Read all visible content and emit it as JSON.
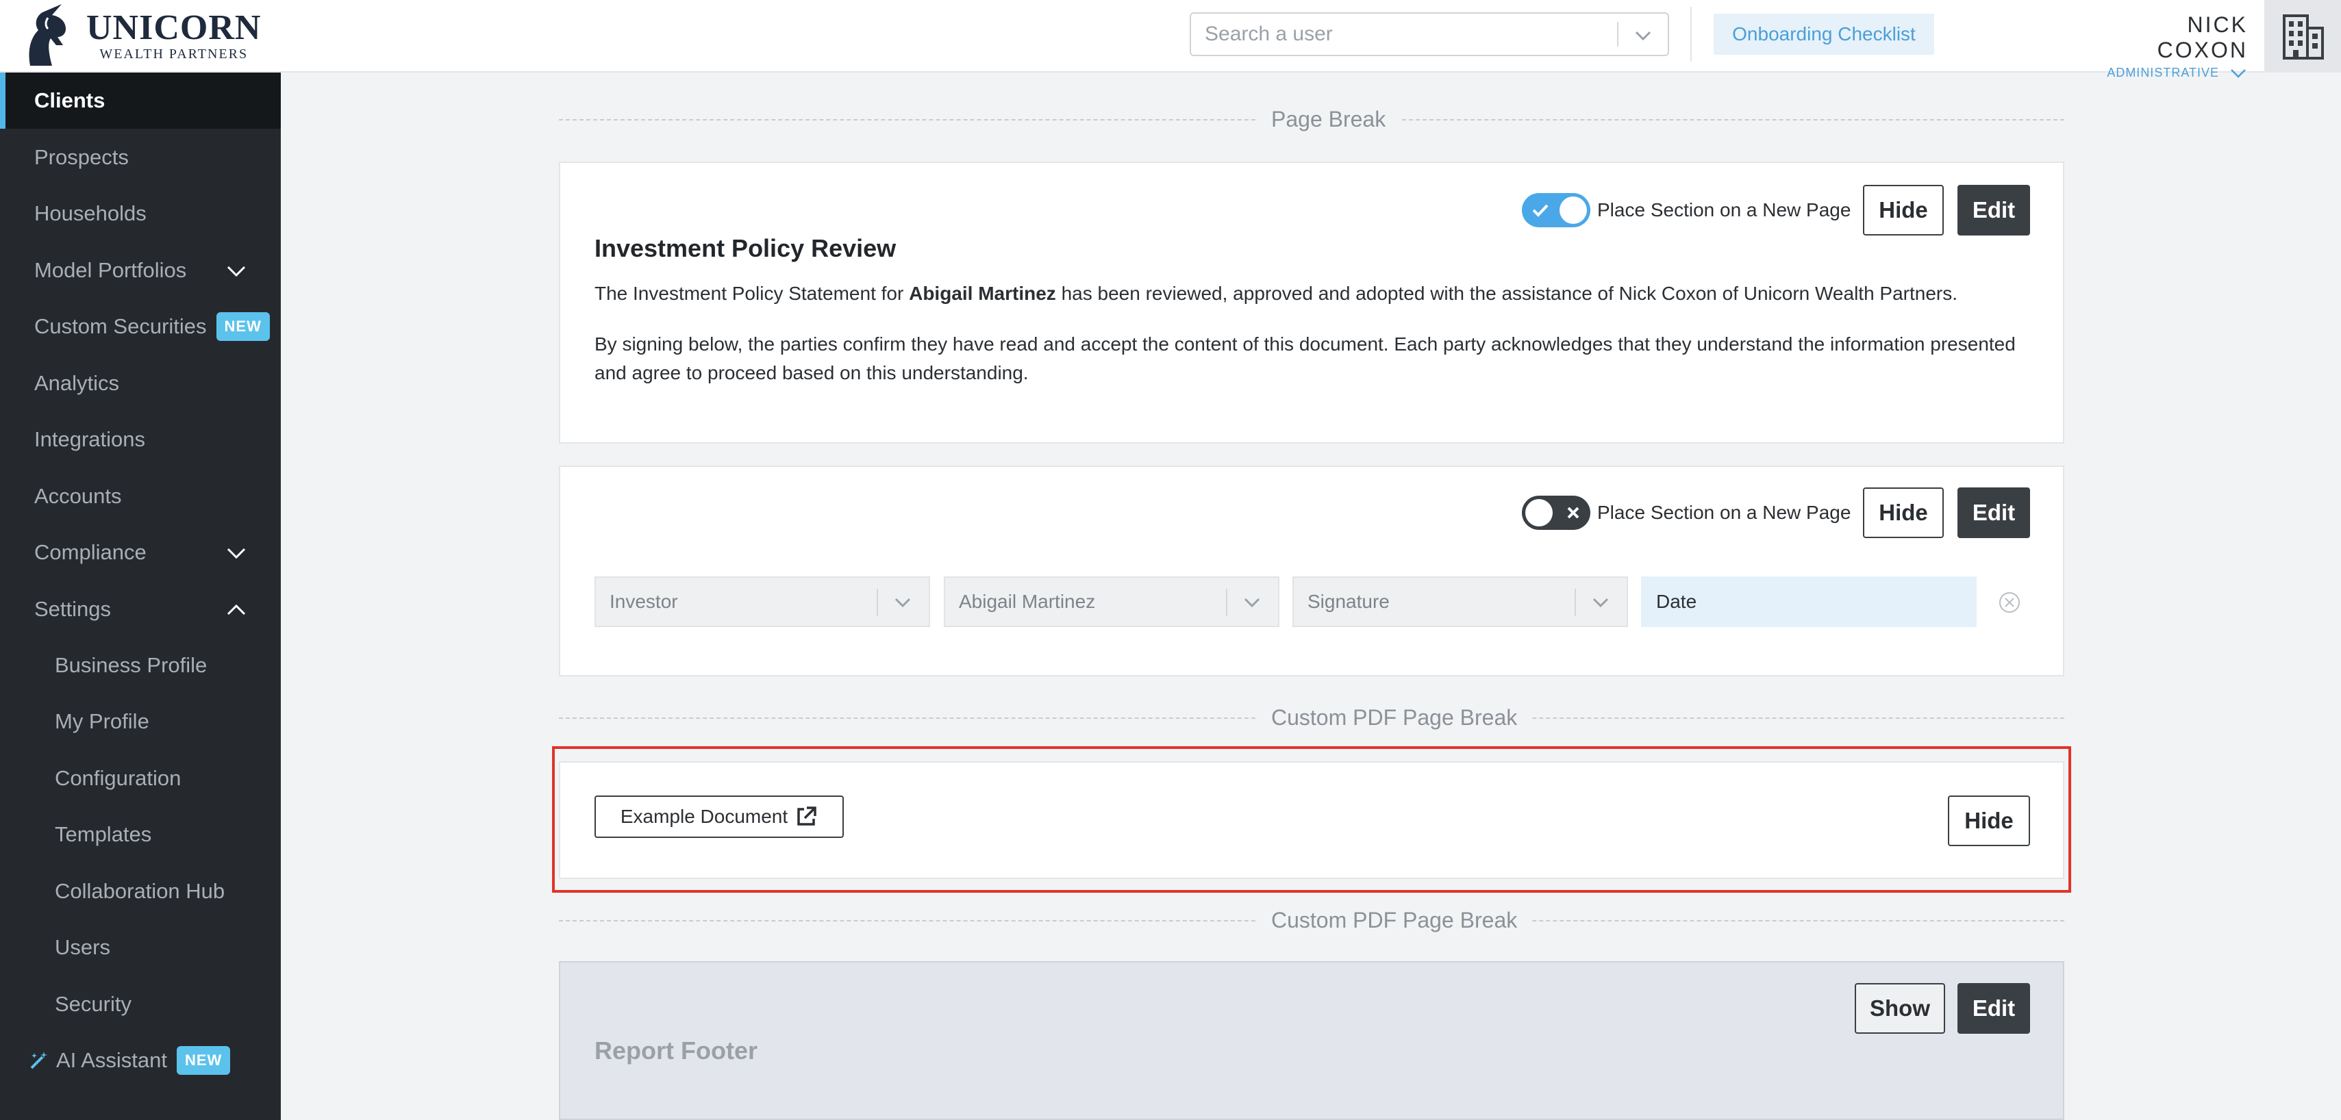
{
  "brand": {
    "name": "UNICORN",
    "subtitle": "WEALTH PARTNERS"
  },
  "header": {
    "search_placeholder": "Search a user",
    "onboarding_label": "Onboarding Checklist",
    "user_name": "NICK COXON",
    "user_role": "ADMINISTRATIVE"
  },
  "sidebar": {
    "items": [
      {
        "label": "Clients"
      },
      {
        "label": "Prospects"
      },
      {
        "label": "Households"
      },
      {
        "label": "Model Portfolios"
      },
      {
        "label": "Custom Securities",
        "badge": "NEW"
      },
      {
        "label": "Analytics"
      },
      {
        "label": "Integrations"
      },
      {
        "label": "Accounts"
      },
      {
        "label": "Compliance"
      },
      {
        "label": "Settings"
      },
      {
        "label": "Business Profile"
      },
      {
        "label": "My Profile"
      },
      {
        "label": "Configuration"
      },
      {
        "label": "Templates"
      },
      {
        "label": "Collaboration Hub"
      },
      {
        "label": "Users"
      },
      {
        "label": "Security"
      },
      {
        "label": "AI Assistant",
        "badge": "NEW"
      }
    ]
  },
  "main": {
    "page_break_label": "Page Break",
    "section1": {
      "toggle_label": "Place Section on a New Page",
      "hide_label": "Hide",
      "edit_label": "Edit",
      "title": "Investment Policy Review",
      "p1_before": "The Investment Policy Statement for ",
      "p1_name": "Abigail Martinez",
      "p1_after": " has been reviewed, approved and adopted with the assistance of Nick Coxon of Unicorn Wealth Partners.",
      "p2": "By signing below, the parties confirm they have read and accept the content of this document. Each party acknowledges that they understand the information presented and agree to proceed based on this understanding."
    },
    "section2": {
      "toggle_label": "Place Section on a New Page",
      "hide_label": "Hide",
      "edit_label": "Edit",
      "field_role": "Investor",
      "field_name": "Abigail Martinez",
      "field_type": "Signature",
      "field_date": "Date"
    },
    "custom_break_1": "Custom PDF Page Break",
    "custom_pdf": {
      "doc_label": "Example Document",
      "hide_label": "Hide"
    },
    "custom_break_2": "Custom PDF Page Break",
    "footer": {
      "title": "Report Footer",
      "show_label": "Show",
      "edit_label": "Edit"
    }
  },
  "colors": {
    "accent": "#4aa8e8",
    "sidebar_bg": "#25292d",
    "highlight": "#e0342a",
    "badge": "#5bc2ec"
  }
}
